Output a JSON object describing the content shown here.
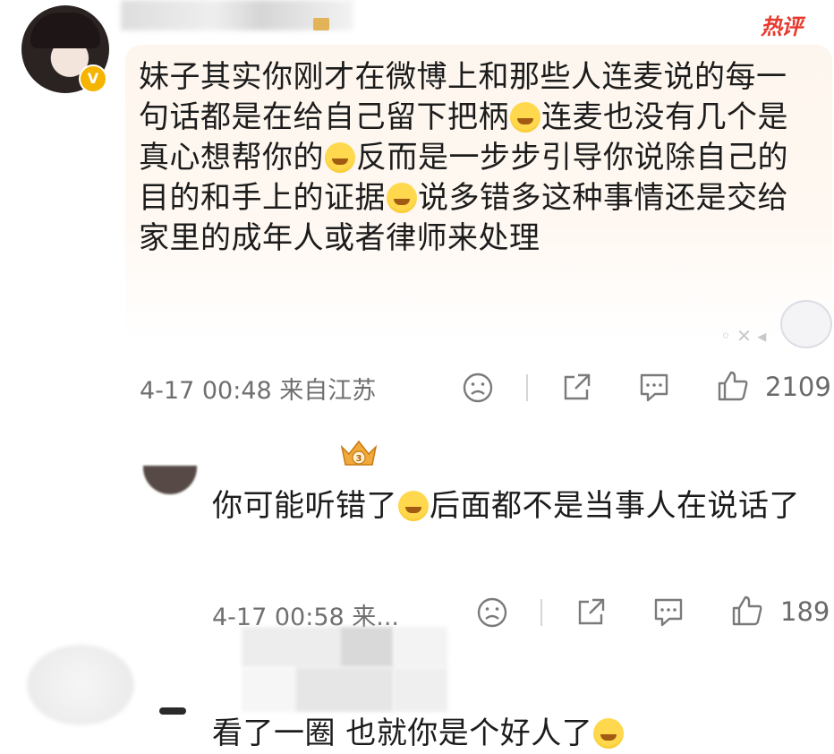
{
  "header": {
    "hot_tag": "热评"
  },
  "comments": [
    {
      "text_segments": [
        "妹子其实你刚才在微博上和那些人连麦说的每一句话都是在给自己留下把柄",
        "连麦也没有几个是真心想帮你的",
        "反而是一步步引导你说除自己的目的和手上的证据",
        "说多错多这种事情还是交给家里的成年人或者律师来处理"
      ],
      "meta": "4-17 00:48  来自江苏",
      "likes": "2109",
      "verified": true,
      "verified_icon": "v-badge-icon"
    },
    {
      "text_segments": [
        "你可能听错了",
        "后面都不是当事人在说话了"
      ],
      "meta": "4-17 00:58  来...",
      "likes": "189",
      "badge_icon": "crown-level-3-icon"
    },
    {
      "text_segments": [
        "看了一圈 也就你是个好人了"
      ]
    }
  ],
  "icons": {
    "dislike": "frown-face-icon",
    "share": "share-icon",
    "comment": "comment-icon",
    "like": "thumbs-up-icon"
  },
  "colors": {
    "hot": "#e8392e",
    "verified": "#f5b400",
    "meta": "#6f6f6f"
  }
}
